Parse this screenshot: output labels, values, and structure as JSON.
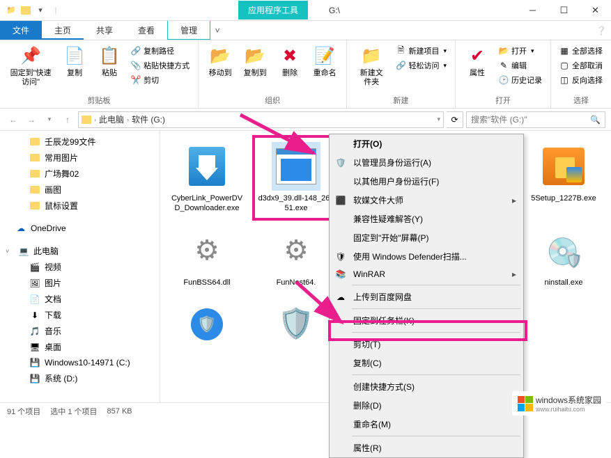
{
  "title": {
    "context_tab": "应用程序工具",
    "path_short": "G:\\"
  },
  "tabs": {
    "file": "文件",
    "home": "主页",
    "share": "共享",
    "view": "查看",
    "manage": "管理"
  },
  "ribbon": {
    "clipboard": {
      "pin": "固定到\"快速访问\"",
      "copy": "复制",
      "paste": "粘贴",
      "copy_path": "复制路径",
      "paste_shortcut": "粘贴快捷方式",
      "cut": "剪切",
      "label": "剪贴板"
    },
    "organize": {
      "move_to": "移动到",
      "copy_to": "复制到",
      "delete": "删除",
      "rename": "重命名",
      "label": "组织"
    },
    "new": {
      "new_folder": "新建文件夹",
      "new_item": "新建项目",
      "easy_access": "轻松访问",
      "label": "新建"
    },
    "open": {
      "properties": "属性",
      "open": "打开",
      "edit": "编辑",
      "history": "历史记录",
      "label": "打开"
    },
    "select": {
      "select_all": "全部选择",
      "select_none": "全部取消",
      "invert": "反向选择",
      "label": "选择"
    }
  },
  "breadcrumb": {
    "pc": "此电脑",
    "drive": "软件 (G:)"
  },
  "search": {
    "placeholder": "搜索\"软件 (G:)\""
  },
  "sidebar": {
    "folders": [
      "壬辰龙99文件",
      "常用图片",
      "广场舞02",
      "画图",
      "鼠标设置"
    ],
    "onedrive": "OneDrive",
    "thispc": "此电脑",
    "pc_items": [
      "视频",
      "图片",
      "文档",
      "下载",
      "音乐",
      "桌面",
      "Windows10-14971 (C:)",
      "系统 (D:)"
    ]
  },
  "files": [
    {
      "name": "CyberLink_PowerDVD_Downloader.exe",
      "icon": "download"
    },
    {
      "name": "d3dx9_39.dll-148_26651.exe",
      "icon": "window",
      "selected": true
    },
    {
      "name": "...",
      "icon": "blank"
    },
    {
      "name": "...",
      "icon": "blank"
    },
    {
      "name": "5Setup_1227B.exe",
      "icon": "box"
    },
    {
      "name": "FunBSS64.dll",
      "icon": "gear"
    },
    {
      "name": "FunNest64.",
      "icon": "gear"
    },
    {
      "name": "",
      "icon": "blank"
    },
    {
      "name": "",
      "icon": "blank"
    },
    {
      "name": "ninstall.exe",
      "icon": "uninstall"
    },
    {
      "name": "",
      "icon": "shieldapp"
    },
    {
      "name": "",
      "icon": "redshield"
    }
  ],
  "context_menu": [
    {
      "label": "打开(O)",
      "bold": true
    },
    {
      "label": "以管理员身份运行(A)",
      "icon": "shield"
    },
    {
      "label": "以其他用户身份运行(F)"
    },
    {
      "label": "软媒文件大师",
      "icon": "app",
      "submenu": true
    },
    {
      "label": "兼容性疑难解答(Y)"
    },
    {
      "label": "固定到\"开始\"屏幕(P)"
    },
    {
      "label": "使用 Windows Defender扫描...",
      "icon": "defender"
    },
    {
      "label": "WinRAR",
      "icon": "rar",
      "submenu": true
    },
    {
      "sep": true
    },
    {
      "label": "上传到百度网盘",
      "icon": "cloud"
    },
    {
      "sep": true
    },
    {
      "label": "固定到任务栏(K)"
    },
    {
      "sep": true
    },
    {
      "label": "剪切(T)"
    },
    {
      "label": "复制(C)"
    },
    {
      "sep": true
    },
    {
      "label": "创建快捷方式(S)"
    },
    {
      "label": "删除(D)"
    },
    {
      "label": "重命名(M)"
    },
    {
      "sep": true
    },
    {
      "label": "属性(R)"
    }
  ],
  "statusbar": {
    "count": "91 个项目",
    "selected": "选中 1 个项目",
    "size": "857 KB"
  },
  "watermark": {
    "brand": "windows系统家园",
    "url": "www.ruihaitu.com"
  }
}
